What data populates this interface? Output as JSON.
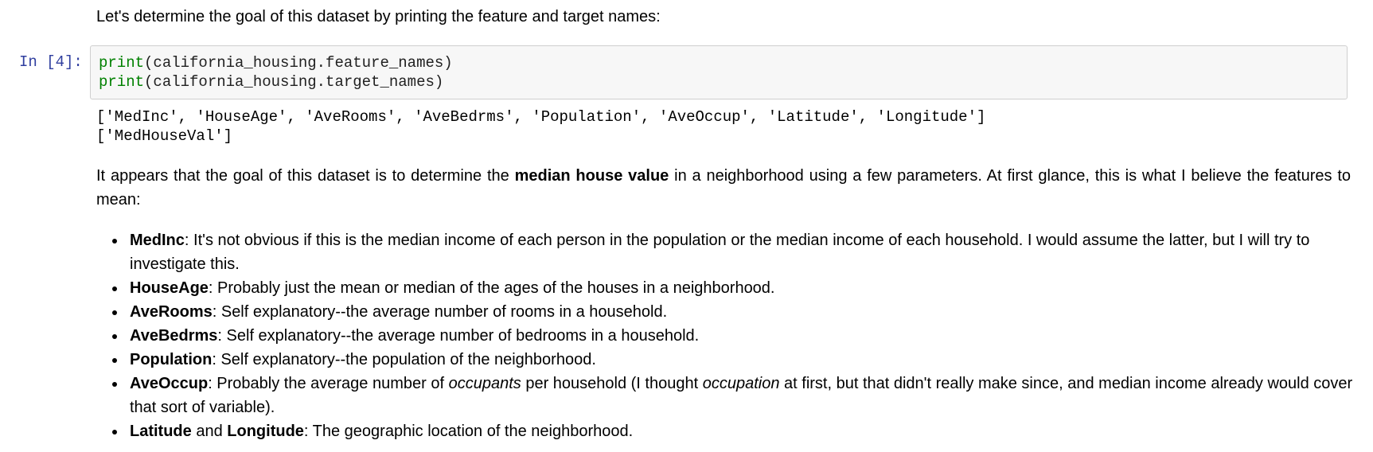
{
  "intro": "Let's determine the goal of this dataset by printing the feature and target names:",
  "cell": {
    "prompt": "In [4]:",
    "lines": [
      {
        "fn": "print",
        "args": "(california_housing.feature_names)"
      },
      {
        "fn": "print",
        "args": "(california_housing.target_names)"
      }
    ]
  },
  "output": {
    "lines": [
      "['MedInc', 'HouseAge', 'AveRooms', 'AveBedrms', 'Population', 'AveOccup', 'Latitude', 'Longitude']",
      "['MedHouseVal']"
    ]
  },
  "paragraph": {
    "before": "It appears that the goal of this dataset is to determine the ",
    "bold": "median house value",
    "after": " in a neighborhood using a few parameters. At first glance, this is what I believe the features to mean:"
  },
  "features": [
    {
      "name": "MedInc",
      "text": ": It's not obvious if this is the median income of each person in the population or the median income of each household. I would assume the latter, but I will try to investigate this."
    },
    {
      "name": "HouseAge",
      "text": ": Probably just the mean or median of the ages of the houses in a neighborhood."
    },
    {
      "name": "AveRooms",
      "text": ": Self explanatory--the average number of rooms in a household."
    },
    {
      "name": "AveBedrms",
      "text": ": Self explanatory--the average number of bedrooms in a household."
    },
    {
      "name": "Population",
      "text": ": Self explanatory--the population of the neighborhood."
    }
  ],
  "aveoccup": {
    "name": "AveOccup",
    "t1": ": Probably the average number of ",
    "i1": "occupants",
    "t2": " per household (I thought ",
    "i2": "occupation",
    "t3": " at first, but that didn't really make since, and median income already would cover that sort of variable)."
  },
  "latlon": {
    "name1": "Latitude",
    "mid": " and ",
    "name2": "Longitude",
    "text": ": The geographic location of the neighborhood."
  }
}
